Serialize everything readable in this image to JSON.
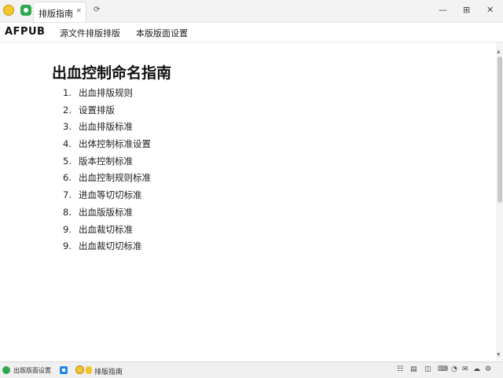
{
  "window": {
    "tab_title": "排版指南",
    "tab_close": "×",
    "new_tab": "⟳",
    "minimize": "—",
    "maximize": "⊞",
    "close": "✕"
  },
  "menubar": {
    "brand": "AFPUB",
    "items": [
      "源文件排版排版",
      "本版版面设置"
    ]
  },
  "page": {
    "title": "出血控制命名指南",
    "items": [
      {
        "num": "1.",
        "text": "出血排版规则"
      },
      {
        "num": "2.",
        "text": "设置排版"
      },
      {
        "num": "3.",
        "text": "出血排版标准"
      },
      {
        "num": "4.",
        "text": "出体控制标准设置"
      },
      {
        "num": "5.",
        "text": "版本控制标准"
      },
      {
        "num": "6.",
        "text": "出血控制规则标准"
      },
      {
        "num": "7.",
        "text": "进血等切切标准"
      },
      {
        "num": "8.",
        "text": "出血版版标准"
      },
      {
        "num": "9.",
        "text": "出血裁切标准"
      },
      {
        "num": "9.",
        "text": "出血裁切切标准"
      }
    ]
  },
  "taskbar": {
    "item_1": "出版版面设置",
    "item_2": "排版指南"
  },
  "tray": {
    "icons": [
      "network-icon",
      "volume-icon",
      "battery-icon",
      "keyboard-icon",
      "wifi-icon",
      "notification-icon",
      "cloud-icon",
      "settings-icon"
    ],
    "glyphs": [
      "☷",
      "▤",
      "◫",
      "⌨",
      "◔",
      "✉",
      "☁",
      "⚙"
    ]
  },
  "colors": {
    "titlebar": "#f3f3f3",
    "accent_green": "#2fa84f",
    "accent_yellow": "#f5c531",
    "accent_blue": "#1e88e5",
    "scroll_thumb": "#c9c9c9"
  }
}
